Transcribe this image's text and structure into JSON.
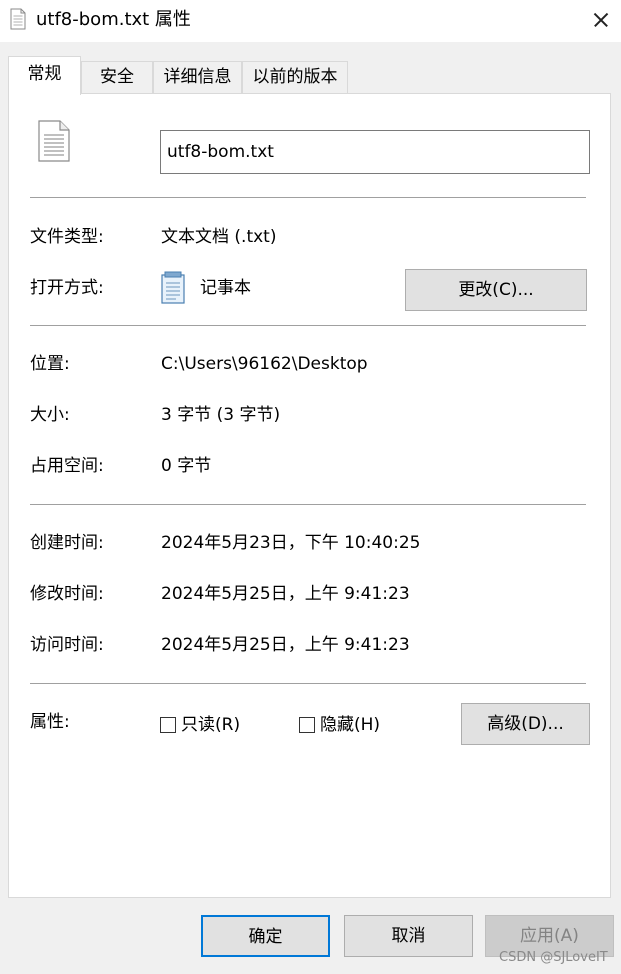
{
  "window": {
    "title": "utf8-bom.txt 属性",
    "icons": [
      "text-file-icon",
      "close-icon"
    ]
  },
  "tabs": [
    {
      "label": "常规",
      "active": true
    },
    {
      "label": "安全",
      "active": false
    },
    {
      "label": "详细信息",
      "active": false
    },
    {
      "label": "以前的版本",
      "active": false
    }
  ],
  "general": {
    "file_name": "utf8-bom.txt",
    "file_type_label": "文件类型:",
    "file_type_value": "文本文档 (.txt)",
    "open_with_label": "打开方式:",
    "open_with_value": "记事本",
    "change_button": "更改(C)...",
    "location_label": "位置:",
    "location_value": "C:\\Users\\96162\\Desktop",
    "size_label": "大小:",
    "size_value": "3 字节 (3 字节)",
    "size_on_disk_label": "占用空间:",
    "size_on_disk_value": "0 字节",
    "created_label": "创建时间:",
    "created_value": "2024年5月23日，下午 10:40:25",
    "modified_label": "修改时间:",
    "modified_value": "2024年5月25日，上午 9:41:23",
    "accessed_label": "访问时间:",
    "accessed_value": "2024年5月25日，上午 9:41:23",
    "attributes_label": "属性:",
    "readonly_label": "只读(R)",
    "readonly_checked": false,
    "hidden_label": "隐藏(H)",
    "hidden_checked": false,
    "advanced_button": "高级(D)..."
  },
  "footer": {
    "ok": "确定",
    "cancel": "取消",
    "apply": "应用(A)",
    "apply_enabled": false
  },
  "watermark": "CSDN @SJLoveIT",
  "colors": {
    "accent": "#0078d7",
    "panel_bg": "#ffffff",
    "window_bg": "#f0f0f0",
    "button_bg": "#e1e1e1"
  }
}
